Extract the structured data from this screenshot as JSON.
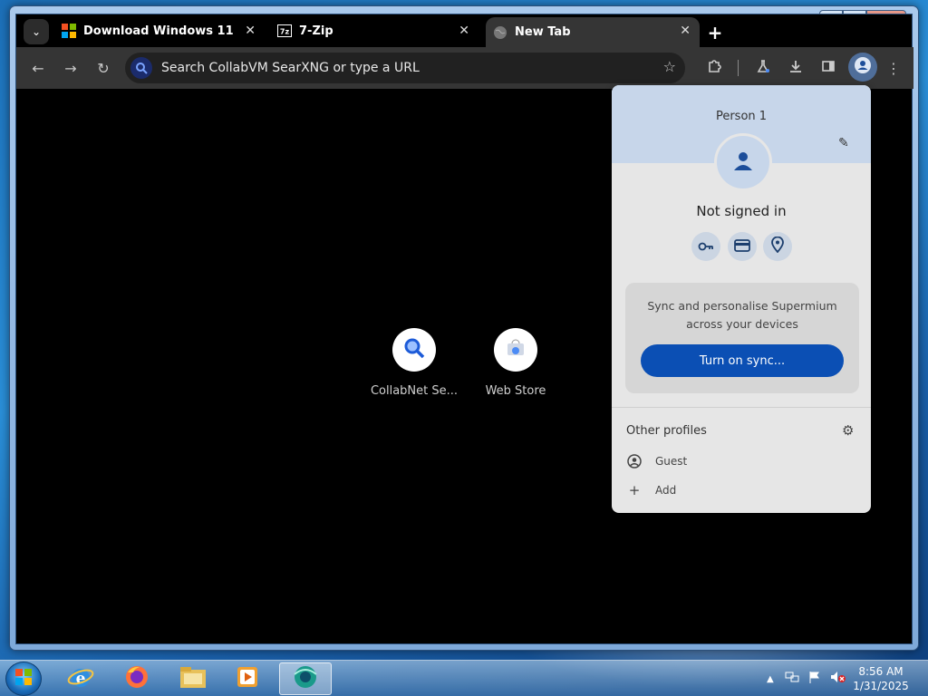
{
  "browser": {
    "tabs": [
      {
        "title": "Download Windows 11",
        "favicon": "windows-logo-icon",
        "active": false
      },
      {
        "title": "7-Zip",
        "favicon": "7zip-icon",
        "active": false
      },
      {
        "title": "New Tab",
        "favicon": "globe-icon",
        "active": true
      }
    ],
    "omnibox_placeholder": "Search CollabVM SearXNG or type a URL",
    "shortcuts": [
      {
        "label": "CollabNet Se...",
        "icon": "search-icon"
      },
      {
        "label": "Web Store",
        "icon": "web-store-icon"
      }
    ]
  },
  "profile_menu": {
    "name": "Person 1",
    "status": "Not signed in",
    "sync_text_line1": "Sync and personalise Supermium",
    "sync_text_line2": "across your devices",
    "sync_button": "Turn on sync...",
    "other_profiles_label": "Other profiles",
    "guest_label": "Guest",
    "add_label": "Add"
  },
  "taskbar": {
    "time": "8:56 AM",
    "date": "1/31/2025",
    "apps": [
      "internet-explorer",
      "firefox",
      "file-explorer",
      "media-player",
      "browser"
    ]
  },
  "colors": {
    "sync_button": "#0b4fb4",
    "profile_header": "#c7d6ea",
    "toolbar": "#353535"
  }
}
